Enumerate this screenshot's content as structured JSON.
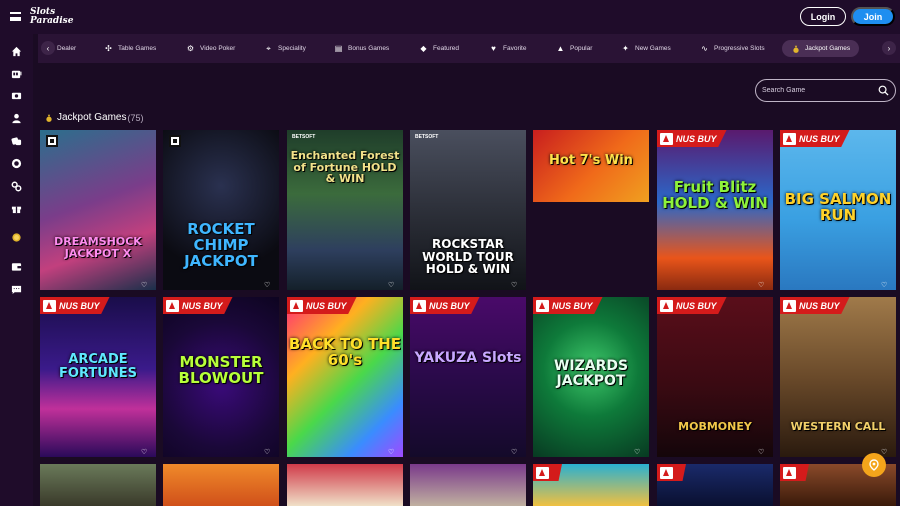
{
  "header": {
    "logo_line1": "Slots",
    "logo_line2": "Paradise",
    "login_label": "Login",
    "join_label": "Join"
  },
  "sidebar": {
    "icons": [
      "home-icon",
      "slots-icon",
      "bonus-icon",
      "user-icon",
      "dice-icon",
      "chip-icon",
      "link-icon",
      "gift-icon",
      "coin-icon",
      "wallet-icon",
      "chat-icon"
    ]
  },
  "categories": [
    {
      "label": "Dealer",
      "icon": "dealer-icon"
    },
    {
      "label": "Table Games",
      "icon": "cards-icon"
    },
    {
      "label": "Video Poker",
      "icon": "poker-chip-icon"
    },
    {
      "label": "Speciality",
      "icon": "speciality-icon"
    },
    {
      "label": "Bonus Games",
      "icon": "bonus-icon"
    },
    {
      "label": "Featured",
      "icon": "diamond-icon"
    },
    {
      "label": "Favorite",
      "icon": "heart-icon"
    },
    {
      "label": "Popular",
      "icon": "thumbs-up-icon"
    },
    {
      "label": "New Games",
      "icon": "sparkle-icon"
    },
    {
      "label": "Progressive Slots",
      "icon": "pulse-icon"
    },
    {
      "label": "Jackpot Games",
      "icon": "money-bag-icon",
      "active": true
    }
  ],
  "search": {
    "placeholder": "Search Game"
  },
  "section": {
    "title": "Jackpot Games",
    "count": "(75)"
  },
  "badge_text": "NUS BUY",
  "games": [
    {
      "title": "DREAMSHOCK JACKPOT X",
      "badge": false
    },
    {
      "title": "ROCKET CHIMP JACKPOT",
      "badge": false
    },
    {
      "title": "Enchanted Forest of Fortune HOLD & WIN",
      "badge": false
    },
    {
      "title": "ROCKSTAR WORLD TOUR HOLD & WIN",
      "badge": false
    },
    {
      "title": "Hot 7's Win",
      "badge": false
    },
    {
      "title": "Fruit Blitz HOLD & WIN",
      "badge": true
    },
    {
      "title": "BIG SALMON RUN",
      "badge": true
    },
    {
      "title": "ARCADE FORTUNES",
      "badge": true
    },
    {
      "title": "MONSTER BLOWOUT",
      "badge": true
    },
    {
      "title": "BACK TO THE 60's",
      "badge": true
    },
    {
      "title": "YAKUZA Slots",
      "badge": true
    },
    {
      "title": "WIZARDS JACKPOT",
      "badge": true
    },
    {
      "title": "MOBMONEY",
      "badge": true
    },
    {
      "title": "WESTERN CALL",
      "badge": true
    }
  ],
  "brand_tag": "BETSOFT"
}
